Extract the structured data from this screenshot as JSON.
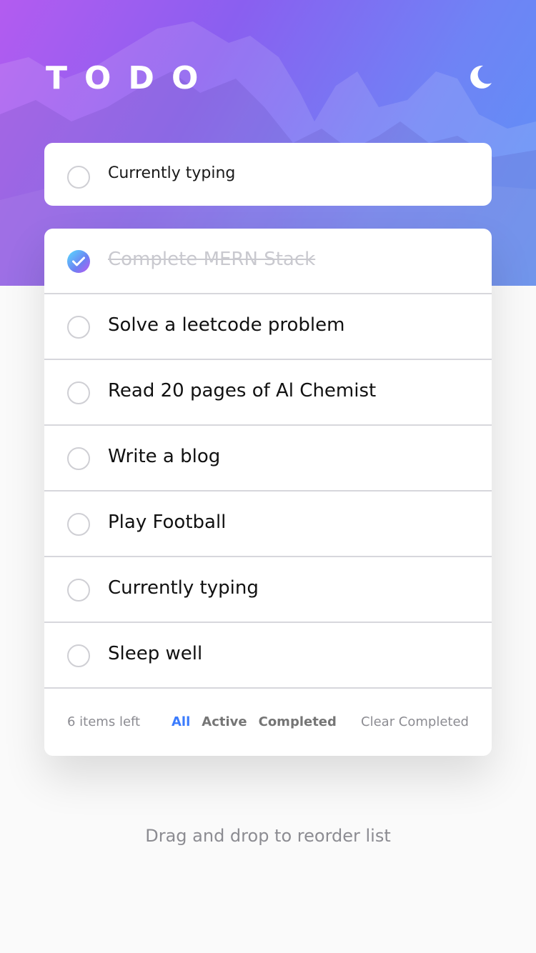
{
  "app": {
    "title": "TODO"
  },
  "theme_toggle": {
    "icon": "moon-icon"
  },
  "new_todo": {
    "placeholder": "Currently typing"
  },
  "todos": [
    {
      "text": "Complete MERN Stack",
      "completed": true
    },
    {
      "text": "Solve a leetcode problem",
      "completed": false
    },
    {
      "text": "Read 20 pages of Al Chemist",
      "completed": false
    },
    {
      "text": "Write a blog",
      "completed": false
    },
    {
      "text": "Play Football",
      "completed": false
    },
    {
      "text": "Currently typing",
      "completed": false
    },
    {
      "text": "Sleep well",
      "completed": false
    }
  ],
  "footer": {
    "items_left": "6 items left",
    "filters": [
      "All",
      "Active",
      "Completed"
    ],
    "active_filter": "All",
    "clear_label": "Clear Completed"
  },
  "hint": "Drag and drop to reorder list",
  "colors": {
    "accent": "#3a7bfd",
    "check_gradient": [
      "#57ddff",
      "#c058f3"
    ],
    "hero_gradient": [
      "#b35cf0",
      "#5c93f6"
    ]
  }
}
